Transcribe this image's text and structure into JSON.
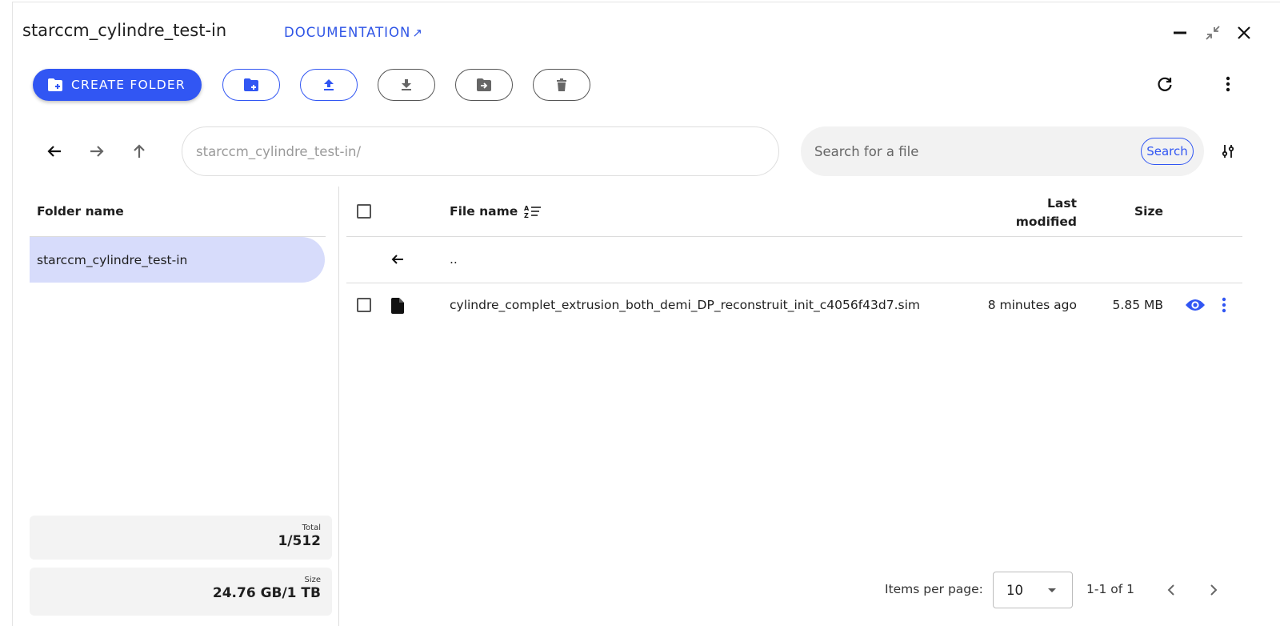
{
  "window": {
    "title": "starccm_cylindre_test-in",
    "documentation_label": "DOCUMENTATION",
    "controls": [
      "minimize-icon",
      "collapse-icon",
      "close-icon"
    ]
  },
  "toolbar": {
    "create_folder_label": "CREATE FOLDER",
    "actions": [
      "new-folder-icon",
      "upload-icon",
      "download-icon",
      "move-icon",
      "delete-icon"
    ],
    "right_actions": [
      "refresh-icon",
      "more-vert-icon"
    ]
  },
  "navigation": {
    "path_value": "starccm_cylindre_test-in/",
    "search_placeholder": "Search for a file",
    "search_button": "Search"
  },
  "folders": {
    "header": "Folder name",
    "items": [
      {
        "label": "starccm_cylindre_test-in",
        "selected": true
      }
    ]
  },
  "stats": {
    "total_label": "Total",
    "total_value": "1/512",
    "size_label": "Size",
    "size_value": "24.76 GB/1 TB"
  },
  "table": {
    "columns": {
      "name": "File name",
      "modified_line1": "Last",
      "modified_line2": "modified",
      "size": "Size"
    },
    "parent_row": "..",
    "rows": [
      {
        "name": "cylindre_complet_extrusion_both_demi_DP_reconstruit_init_c4056f43d7.sim",
        "modified": "8 minutes ago",
        "size": "5.85 MB"
      }
    ]
  },
  "pagination": {
    "items_per_page_label": "Items per page:",
    "items_per_page_value": "10",
    "range": "1-1 of 1"
  },
  "colors": {
    "accent": "#3156f3",
    "selected_folder": "#d7dcfb",
    "search_bg": "#f2f2f2",
    "stat_bg": "#f3f3f3"
  }
}
